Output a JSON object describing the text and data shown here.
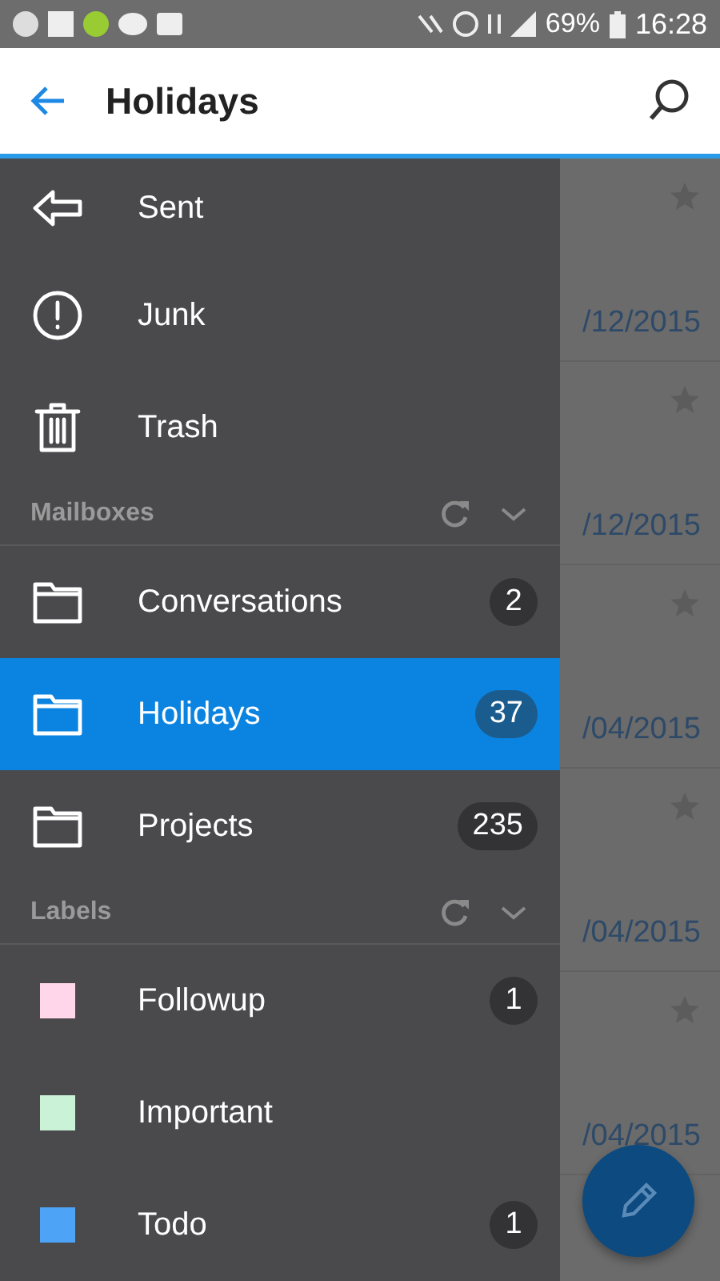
{
  "status_bar": {
    "battery": "69%",
    "time": "16:28"
  },
  "header": {
    "title": "Holidays"
  },
  "drawer": {
    "folders": [
      {
        "kind": "sent",
        "name": "Sent"
      },
      {
        "kind": "junk",
        "name": "Junk"
      },
      {
        "kind": "trash",
        "name": "Trash"
      }
    ],
    "sections": [
      {
        "title": "Mailboxes",
        "items": [
          {
            "kind": "folder",
            "name": "Conversations",
            "count": "2",
            "selected": false
          },
          {
            "kind": "folder",
            "name": "Holidays",
            "count": "37",
            "selected": true
          },
          {
            "kind": "folder",
            "name": "Projects",
            "count": "235",
            "selected": false
          }
        ]
      },
      {
        "title": "Labels",
        "items": [
          {
            "kind": "label",
            "name": "Followup",
            "count": "1",
            "selected": false,
            "color": "#ffd6ea"
          },
          {
            "kind": "label",
            "name": "Important",
            "selected": false,
            "color": "#c9f2d6"
          },
          {
            "kind": "label",
            "name": "Todo",
            "count": "1",
            "selected": false,
            "color": "#4da3f5"
          }
        ]
      }
    ]
  },
  "message_list": [
    {
      "date": "/12/2015"
    },
    {
      "date": "/12/2015"
    },
    {
      "date": "/04/2015"
    },
    {
      "date": "/04/2015"
    },
    {
      "date": "/04/2015"
    }
  ]
}
